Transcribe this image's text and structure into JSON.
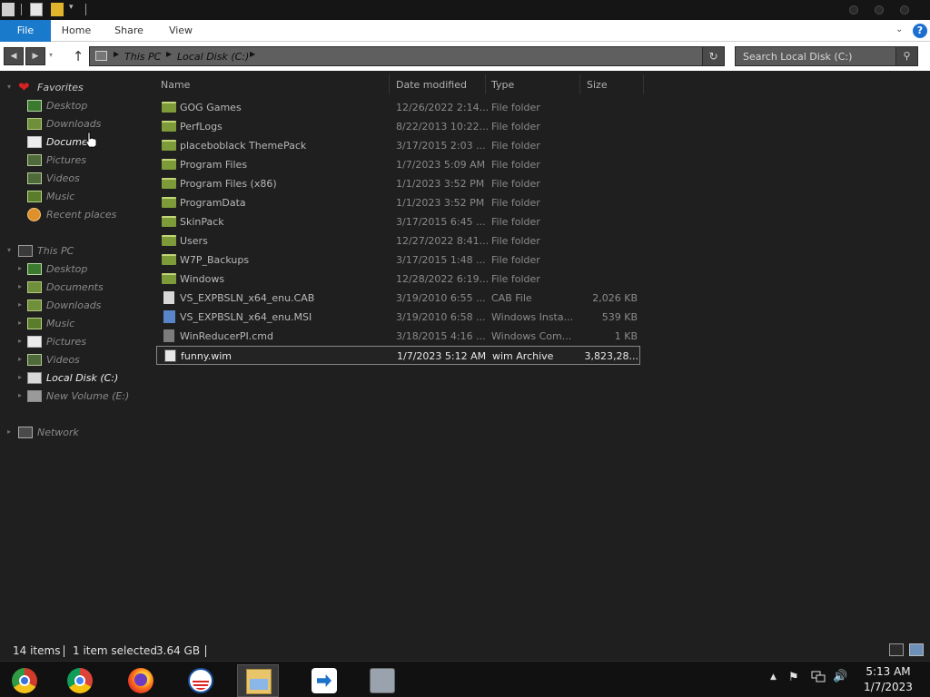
{
  "ribbon": {
    "tabs": [
      "File",
      "Home",
      "Share",
      "View"
    ]
  },
  "address": {
    "crumbs": [
      "This PC",
      "Local Disk (C:)"
    ]
  },
  "search": {
    "placeholder": "Search Local Disk (C:)"
  },
  "nav": {
    "favorites_label": "Favorites",
    "favorites": [
      "Desktop",
      "Downloads",
      "Documents",
      "Pictures",
      "Videos",
      "Music",
      "Recent places"
    ],
    "thispc_label": "This PC",
    "thispc": [
      "Desktop",
      "Documents",
      "Downloads",
      "Music",
      "Pictures",
      "Videos",
      "Local Disk (C:)",
      "New Volume (E:)"
    ],
    "network_label": "Network"
  },
  "filelist": {
    "columns": [
      "Name",
      "Date modified",
      "Type",
      "Size"
    ],
    "rows": [
      {
        "name": "GOG Games",
        "date": "12/26/2022 2:14...",
        "type": "File folder",
        "size": "",
        "icon": "folder-icon"
      },
      {
        "name": "PerfLogs",
        "date": "8/22/2013 10:22...",
        "type": "File folder",
        "size": "",
        "icon": "folder-icon"
      },
      {
        "name": "placeboblack ThemePack",
        "date": "3/17/2015 2:03 ...",
        "type": "File folder",
        "size": "",
        "icon": "folder-icon"
      },
      {
        "name": "Program Files",
        "date": "1/7/2023 5:09 AM",
        "type": "File folder",
        "size": "",
        "icon": "folder-icon"
      },
      {
        "name": "Program Files (x86)",
        "date": "1/1/2023 3:52 PM",
        "type": "File folder",
        "size": "",
        "icon": "folder-icon"
      },
      {
        "name": "ProgramData",
        "date": "1/1/2023 3:52 PM",
        "type": "File folder",
        "size": "",
        "icon": "folder-icon"
      },
      {
        "name": "SkinPack",
        "date": "3/17/2015 6:45 ...",
        "type": "File folder",
        "size": "",
        "icon": "folder-icon"
      },
      {
        "name": "Users",
        "date": "12/27/2022 8:41...",
        "type": "File folder",
        "size": "",
        "icon": "folder-icon"
      },
      {
        "name": "W7P_Backups",
        "date": "3/17/2015 1:48 ...",
        "type": "File folder",
        "size": "",
        "icon": "folder-icon"
      },
      {
        "name": "Windows",
        "date": "12/28/2022 6:19...",
        "type": "File folder",
        "size": "",
        "icon": "folder-icon"
      },
      {
        "name": "VS_EXPBSLN_x64_enu.CAB",
        "date": "3/19/2010 6:55 ...",
        "type": "CAB File",
        "size": "2,026 KB",
        "icon": "cab-file-icon"
      },
      {
        "name": "VS_EXPBSLN_x64_enu.MSI",
        "date": "3/19/2010 6:58 ...",
        "type": "Windows Insta...",
        "size": "539 KB",
        "icon": "msi-file-icon"
      },
      {
        "name": "WinReducerPI.cmd",
        "date": "3/18/2015 4:16 ...",
        "type": "Windows Com...",
        "size": "1 KB",
        "icon": "cmd-file-icon"
      },
      {
        "name": "funny.wim",
        "date": "1/7/2023 5:12 AM",
        "type": "wim Archive",
        "size": "3,823,28...",
        "icon": "wim-file-icon"
      }
    ]
  },
  "status": {
    "items": "14 items",
    "selected": "1 item selected",
    "size": "3.64 GB"
  },
  "clock": {
    "time": "5:13 AM",
    "date": "1/7/2023"
  },
  "taskbar": {
    "apps": [
      "chrome-os-icon",
      "chrome-icon",
      "firefox-icon",
      "obama-logo-icon",
      "file-explorer-icon",
      "teamviewer-icon",
      "archive-tool-icon"
    ]
  },
  "colors": {
    "file_tab": "#1979ca",
    "background": "#1f1f1f",
    "folder": "#7e9b3a"
  }
}
